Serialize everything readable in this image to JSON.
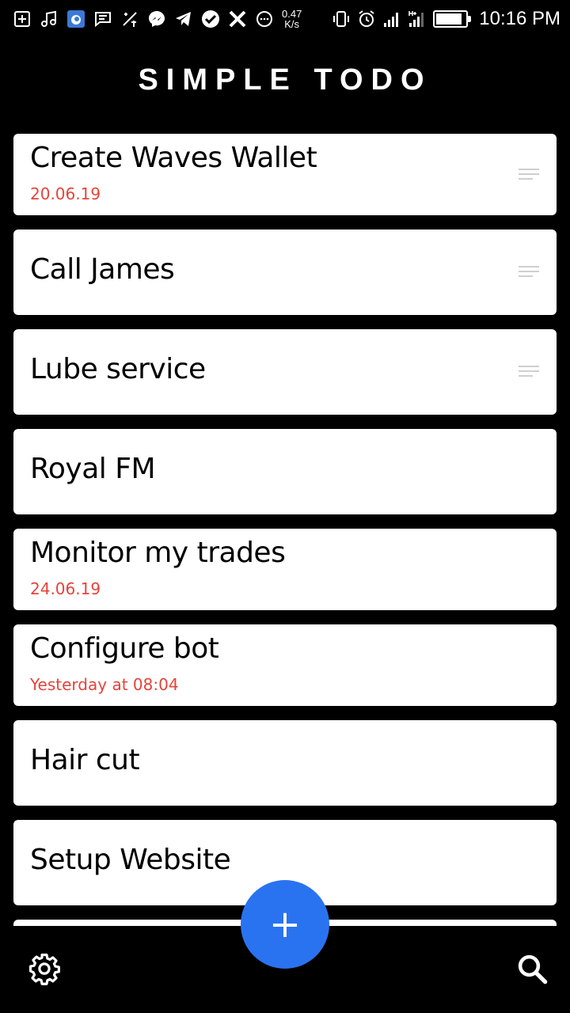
{
  "status_bar": {
    "net_speed_value": "0.47",
    "net_speed_unit": "K/s",
    "time": "10:16 PM",
    "battery_level": 0.9,
    "icons": [
      "add-box-icon",
      "music-note-icon",
      "app-icon",
      "message-icon",
      "tool-icon",
      "messenger-icon",
      "telegram-icon",
      "check-circle-icon",
      "x-icon",
      "chat-bubble-icon",
      "vibrate-icon",
      "alarm-icon",
      "signal-icon",
      "signal-h-plus-icon",
      "battery-icon"
    ]
  },
  "app": {
    "title": "SIMPLE TODO"
  },
  "todos": [
    {
      "title": "Create Waves Wallet",
      "date": "20.06.19",
      "has_note": true
    },
    {
      "title": "Call James",
      "date": "",
      "has_note": true
    },
    {
      "title": "Lube service",
      "date": "",
      "has_note": true
    },
    {
      "title": "Royal FM",
      "date": "",
      "has_note": false
    },
    {
      "title": "Monitor my trades",
      "date": "24.06.19",
      "has_note": false
    },
    {
      "title": "Configure bot",
      "date": "Yesterday at 08:04",
      "has_note": false
    },
    {
      "title": "Hair cut",
      "date": "",
      "has_note": false
    },
    {
      "title": "Setup Website",
      "date": "",
      "has_note": false
    }
  ],
  "fab": {
    "label": "+"
  },
  "colors": {
    "accent": "#2a73f0",
    "date": "#e5443a",
    "background": "#000000",
    "card": "#ffffff"
  }
}
